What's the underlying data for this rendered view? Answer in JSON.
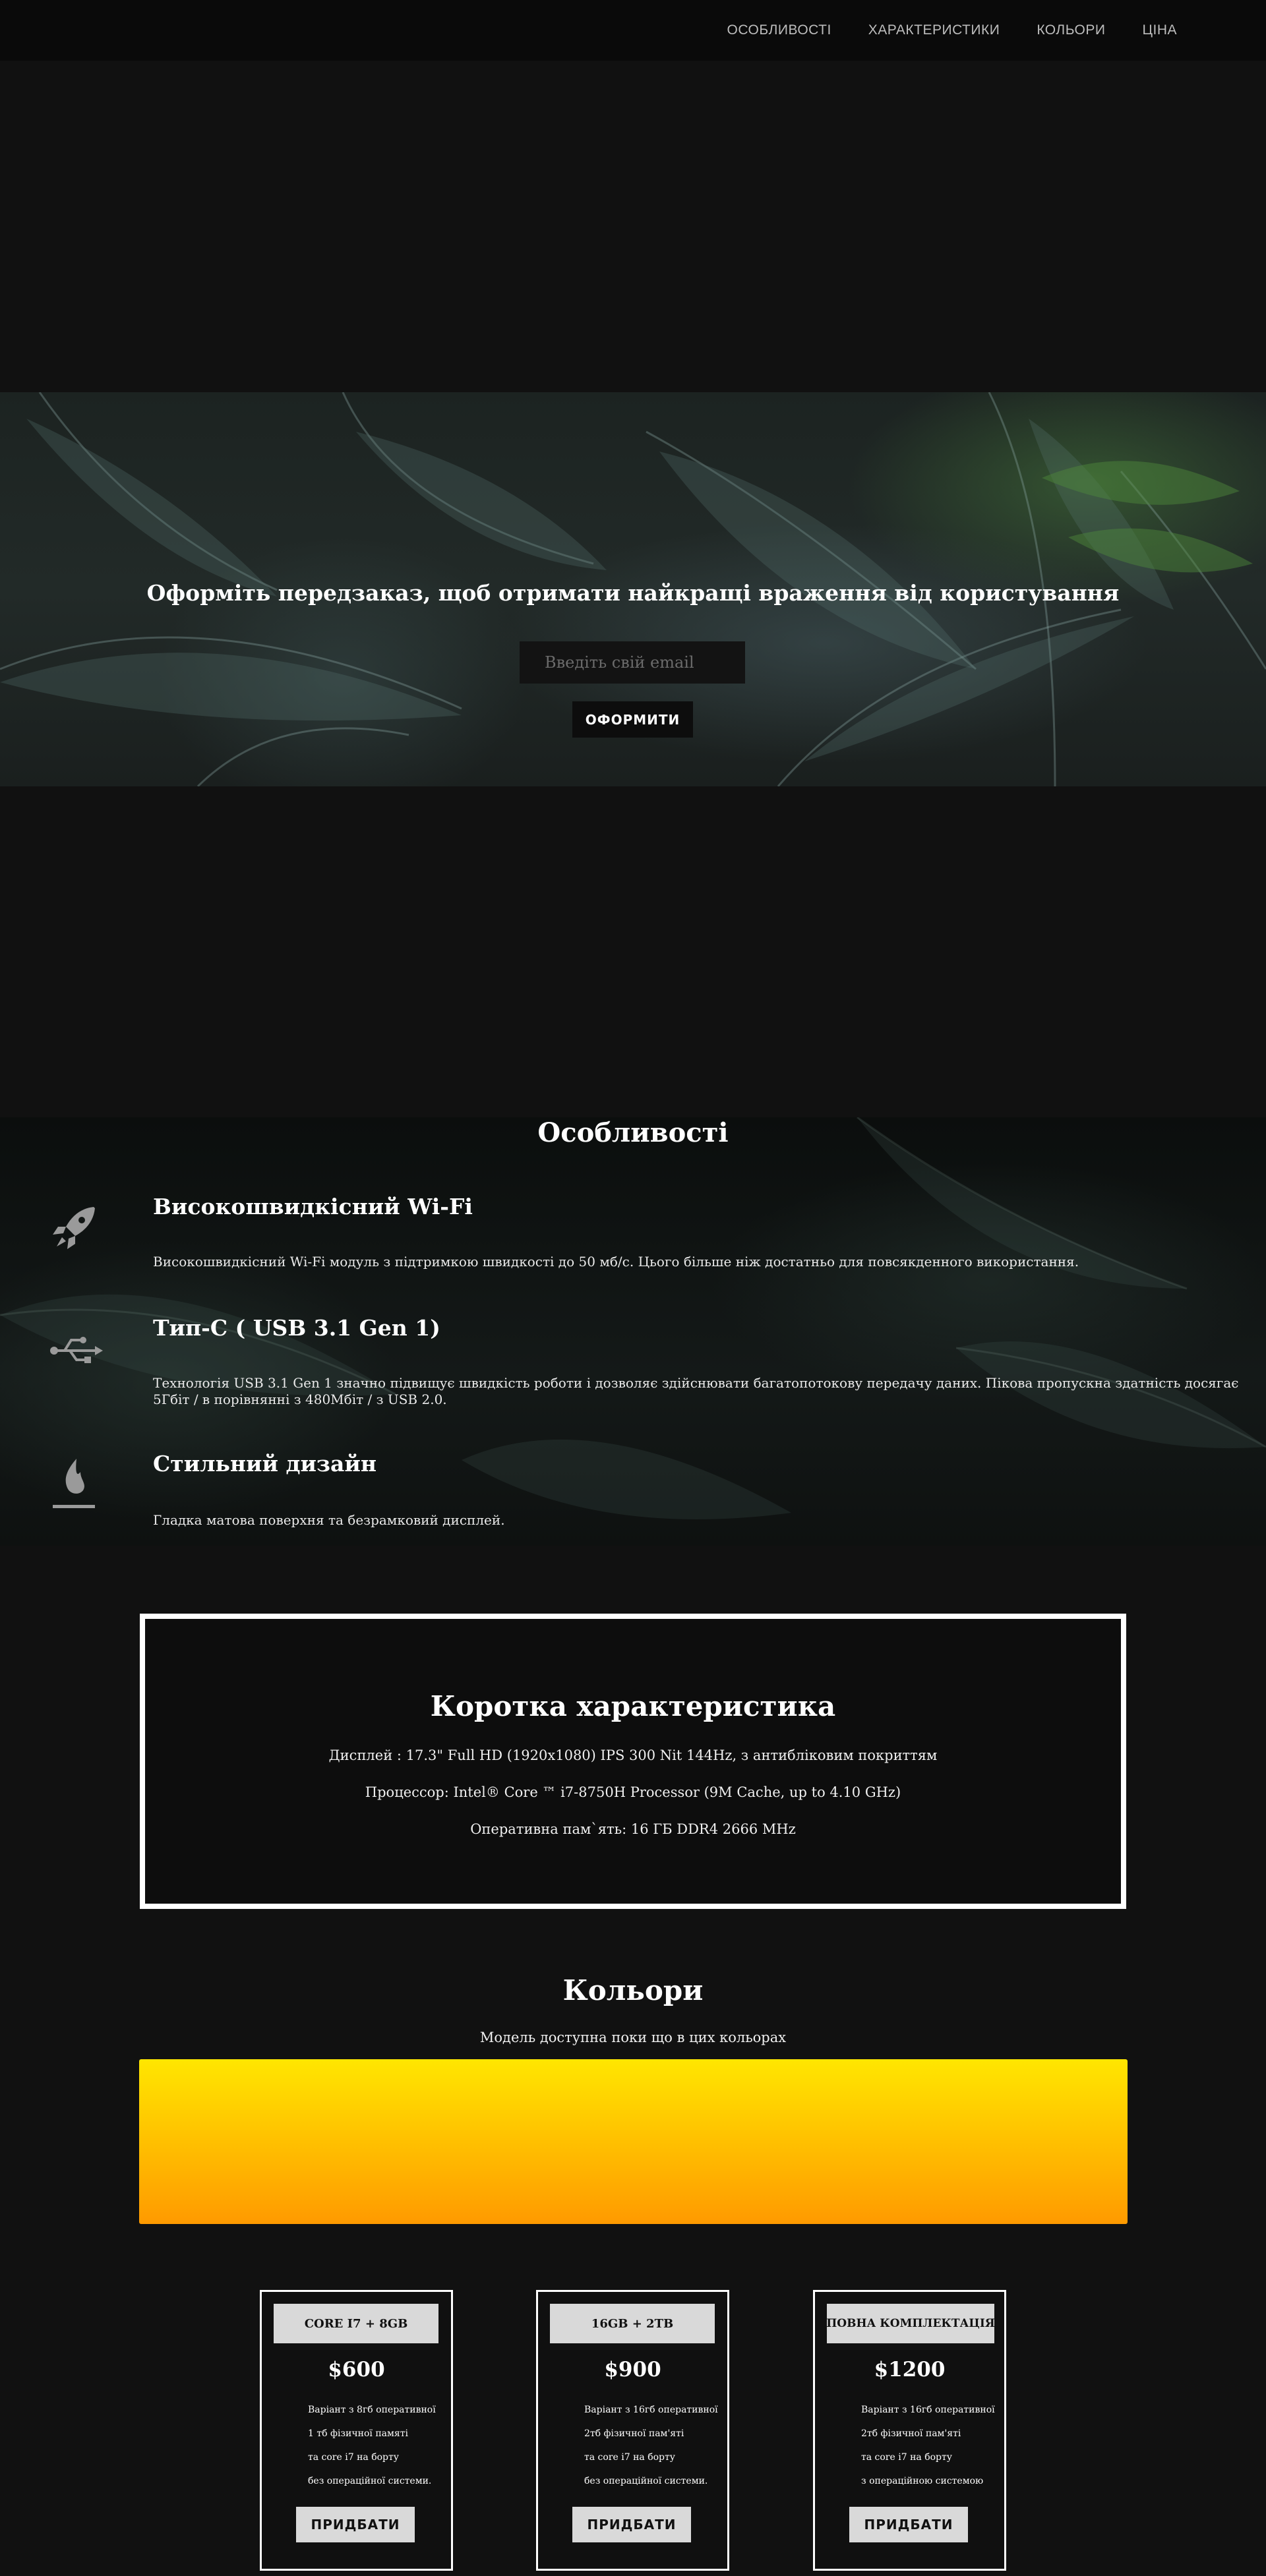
{
  "nav": {
    "items": [
      {
        "label": "ОСОБЛИВОСТІ"
      },
      {
        "label": "ХАРАКТЕРИСТИКИ"
      },
      {
        "label": "КОЛЬОРИ"
      },
      {
        "label": "ЦІНА"
      }
    ]
  },
  "hero": {
    "title": "Оформіть передзаказ, щоб отримати найкращі враження від користування",
    "email_placeholder": "Введіть свій email",
    "submit_label": "ОФОРМИТИ"
  },
  "features": {
    "title": "Особливості",
    "items": [
      {
        "icon": "rocket-icon",
        "heading": "Високошвидкісний Wi-Fi",
        "text": "Високошвидкісний Wi-Fi модуль з підтримкою швидкості до 50 мб/c. Цього більше ніж достатньо для повсякденного використання."
      },
      {
        "icon": "usb-icon",
        "heading": "Тип-C ( USB 3.1 Gen 1)",
        "text": "Технологія USB 3.1 Gen 1 значно підвищує швидкість роботи і дозволяє здійснювати багатопотокову передачу даних. Пікова пропускна здатність досягає 5Гбіт / в порівнянні з 480Мбіт / з USB 2.0."
      },
      {
        "icon": "flame-icon",
        "heading": "Стильний дизайн",
        "text": "Гладка матова поверхня та безрамковий дисплей."
      }
    ]
  },
  "specs": {
    "title": "Коротка характеристика",
    "lines": [
      "Дисплей : 17.3\" Full HD (1920x1080) IPS 300 Nit 144Hz, з антибліковим покриттям",
      "Процессор: Intel® Core ™ i7-8750H Processor (9M Cache, up to 4.10 GHz)",
      "Оперативна пам`ять: 16 ГБ DDR4 2666 MHz"
    ]
  },
  "colors": {
    "title": "Кольори",
    "subtitle": "Модель доступна поки що в цих кольорах",
    "swatch_top": "#ffe600",
    "swatch_bottom": "#ff9a00"
  },
  "pricing": {
    "cards": [
      {
        "plan": "CORE I7 + 8GB",
        "price": "$600",
        "desc": [
          "Варіант з 8гб оперативної",
          "1 тб фізичної памяті",
          "та core i7 на борту",
          "без операційної системи."
        ],
        "button": "ПРИДБАТИ"
      },
      {
        "plan": "16GB + 2TB",
        "price": "$900",
        "desc": [
          "Варіант з 16гб оперативної",
          "2тб фізичної пам'яті",
          "та core i7 на борту",
          "без операційної системи."
        ],
        "button": "ПРИДБАТИ"
      },
      {
        "plan": "ПОВНА КОМПЛЕКТАЦІЯ",
        "price": "$1200",
        "desc": [
          "Варіант з 16гб оперативної",
          "2тб фізичної пам'яті",
          "та core i7 на борту",
          "з операційною системою"
        ],
        "button": "ПРИДБАТИ"
      }
    ]
  }
}
